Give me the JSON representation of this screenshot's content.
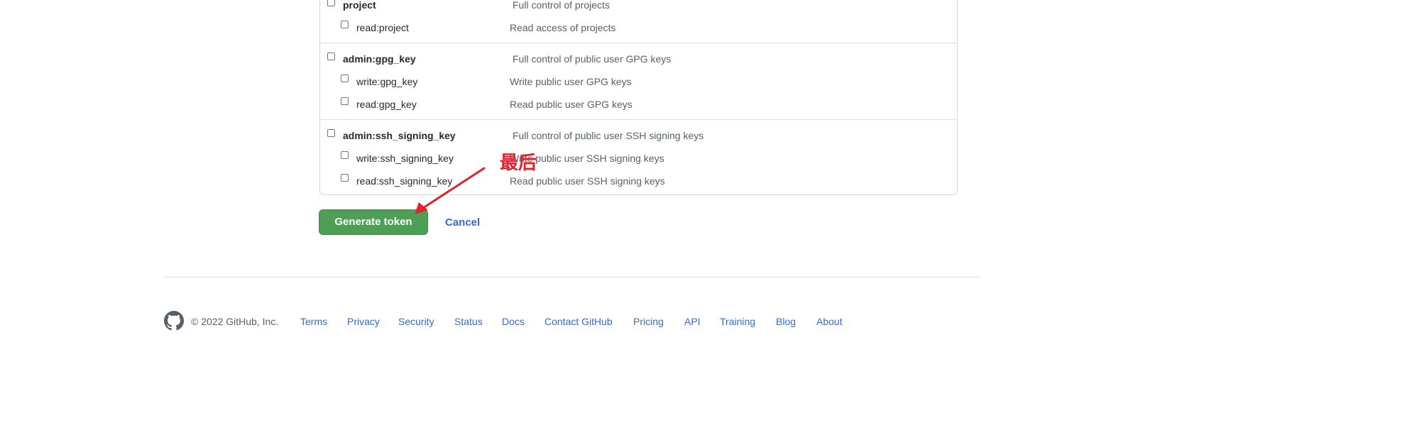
{
  "scopes": [
    {
      "name": "project",
      "bold": true,
      "desc": "Full control of projects"
    },
    {
      "name": "read:project",
      "bold": false,
      "desc": "Read access of projects"
    },
    {
      "name": "admin:gpg_key",
      "bold": true,
      "desc": "Full control of public user GPG keys"
    },
    {
      "name": "write:gpg_key",
      "bold": false,
      "desc": "Write public user GPG keys"
    },
    {
      "name": "read:gpg_key",
      "bold": false,
      "desc": "Read public user GPG keys"
    },
    {
      "name": "admin:ssh_signing_key",
      "bold": true,
      "desc": "Full control of public user SSH signing keys"
    },
    {
      "name": "write:ssh_signing_key",
      "bold": false,
      "desc": "Write public user SSH signing keys"
    },
    {
      "name": "read:ssh_signing_key",
      "bold": false,
      "desc": "Read public user SSH signing keys"
    }
  ],
  "actions": {
    "generate_label": "Generate token",
    "cancel_label": "Cancel"
  },
  "annotation": {
    "text": "最后",
    "color": "#e3222d"
  },
  "footer": {
    "copyright": "© 2022 GitHub, Inc.",
    "links": [
      "Terms",
      "Privacy",
      "Security",
      "Status",
      "Docs",
      "Contact GitHub",
      "Pricing",
      "API",
      "Training",
      "Blog",
      "About"
    ]
  },
  "colors": {
    "primary_button": "#4e9f55",
    "link": "#2f6bd6"
  }
}
